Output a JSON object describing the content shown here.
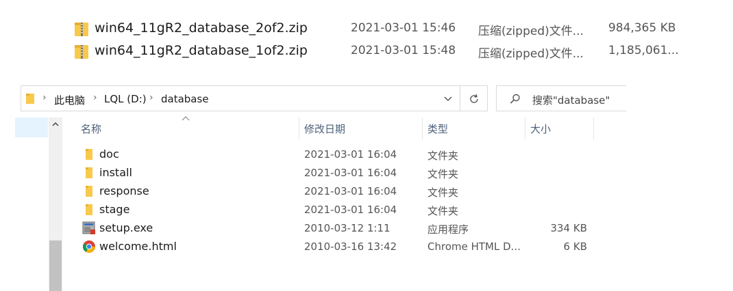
{
  "zip_files": [
    {
      "name": "win64_11gR2_database_2of2.zip",
      "date": "2021-03-01 15:46",
      "type": "压缩(zipped)文件...",
      "size": "984,365 KB"
    },
    {
      "name": "win64_11gR2_database_1of2.zip",
      "date": "2021-03-01 15:48",
      "type": "压缩(zipped)文件...",
      "size": "1,185,061..."
    }
  ],
  "address": {
    "crumbs": [
      "此电脑",
      "LQL (D:)",
      "database"
    ],
    "search_placeholder": "搜索\"database\""
  },
  "columns": {
    "name": "名称",
    "date": "修改日期",
    "type": "类型",
    "size": "大小"
  },
  "files": [
    {
      "name": "doc",
      "date": "2021-03-01 16:04",
      "type": "文件夹",
      "size": "",
      "icon": "folder-icon"
    },
    {
      "name": "install",
      "date": "2021-03-01 16:04",
      "type": "文件夹",
      "size": "",
      "icon": "folder-icon"
    },
    {
      "name": "response",
      "date": "2021-03-01 16:04",
      "type": "文件夹",
      "size": "",
      "icon": "folder-icon"
    },
    {
      "name": "stage",
      "date": "2021-03-01 16:04",
      "type": "文件夹",
      "size": "",
      "icon": "folder-icon"
    },
    {
      "name": "setup.exe",
      "date": "2010-03-12 1:11",
      "type": "应用程序",
      "size": "334 KB",
      "icon": "installer-icon"
    },
    {
      "name": "welcome.html",
      "date": "2010-03-16 13:42",
      "type": "Chrome HTML D...",
      "size": "6 KB",
      "icon": "chrome-icon"
    }
  ],
  "colors": {
    "folder": "#f8c94a",
    "accent": "#0078d7",
    "selection": "#e5f3ff"
  }
}
